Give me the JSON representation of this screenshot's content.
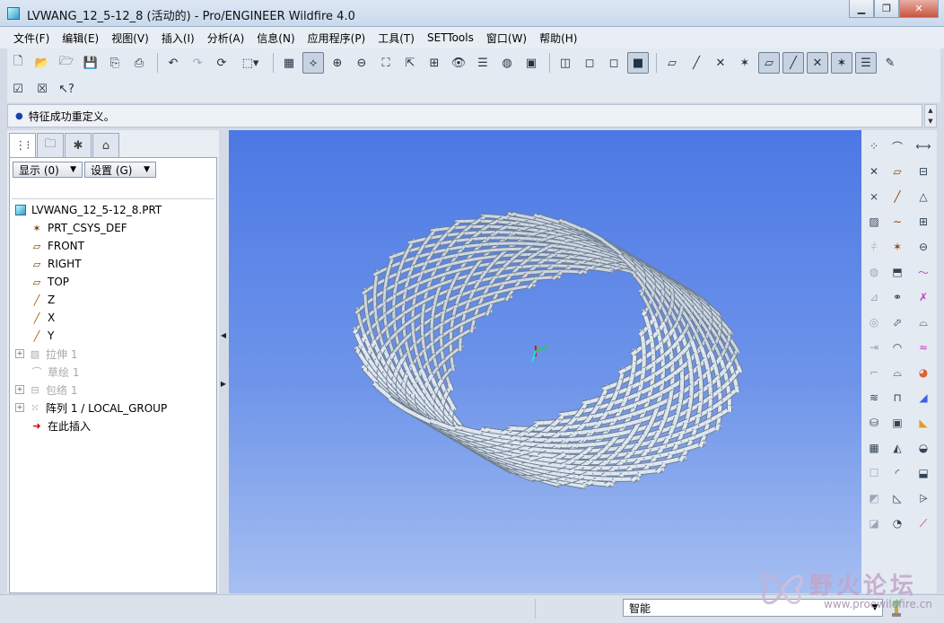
{
  "window": {
    "title": "LVWANG_12_5-12_8 (活动的) - Pro/ENGINEER Wildfire 4.0",
    "buttons": [
      "minimize",
      "maximize",
      "close"
    ]
  },
  "menu": [
    "文件(F)",
    "编辑(E)",
    "视图(V)",
    "插入(I)",
    "分析(A)",
    "信息(N)",
    "应用程序(P)",
    "工具(T)",
    "SETTools",
    "窗口(W)",
    "帮助(H)"
  ],
  "message": "特征成功重定义。",
  "left_panel": {
    "show_label": "显示 (0)",
    "settings_label": "设置 (G)",
    "tree": [
      {
        "label": "LVWANG_12_5-12_8.PRT",
        "icon": "part-icon",
        "kind": "root"
      },
      {
        "label": "PRT_CSYS_DEF",
        "icon": "csys-icon",
        "kind": "child"
      },
      {
        "label": "FRONT",
        "icon": "datum-plane-icon",
        "kind": "child"
      },
      {
        "label": "RIGHT",
        "icon": "datum-plane-icon",
        "kind": "child"
      },
      {
        "label": "TOP",
        "icon": "datum-plane-icon",
        "kind": "child"
      },
      {
        "label": "Z",
        "icon": "datum-axis-icon",
        "kind": "child"
      },
      {
        "label": "X",
        "icon": "datum-axis-icon",
        "kind": "child"
      },
      {
        "label": "Y",
        "icon": "datum-axis-icon",
        "kind": "child"
      },
      {
        "label": "拉伸 1",
        "icon": "extrude-icon",
        "kind": "expandable",
        "suppressed": true
      },
      {
        "label": "草绘 1",
        "icon": "sketch-icon",
        "kind": "expandable",
        "suppressed": true
      },
      {
        "label": "包络 1",
        "icon": "wrap-icon",
        "kind": "expandable",
        "suppressed": true
      },
      {
        "label": "阵列 1 / LOCAL_GROUP",
        "icon": "pattern-icon",
        "kind": "expandable"
      },
      {
        "label": "在此插入",
        "icon": "insert-here-icon",
        "kind": "child"
      }
    ]
  },
  "status": {
    "filter_value": "智能"
  },
  "watermark": {
    "text": "野火论坛",
    "url": "www.proewildfire.cn"
  },
  "colors": {
    "title_bar": "#c9d9ec",
    "graphics_top": "#4b78e4",
    "graphics_bottom": "#a6bff2",
    "mesh_fill": "#dfe8f2",
    "mesh_shade": "#6e7d8e"
  }
}
